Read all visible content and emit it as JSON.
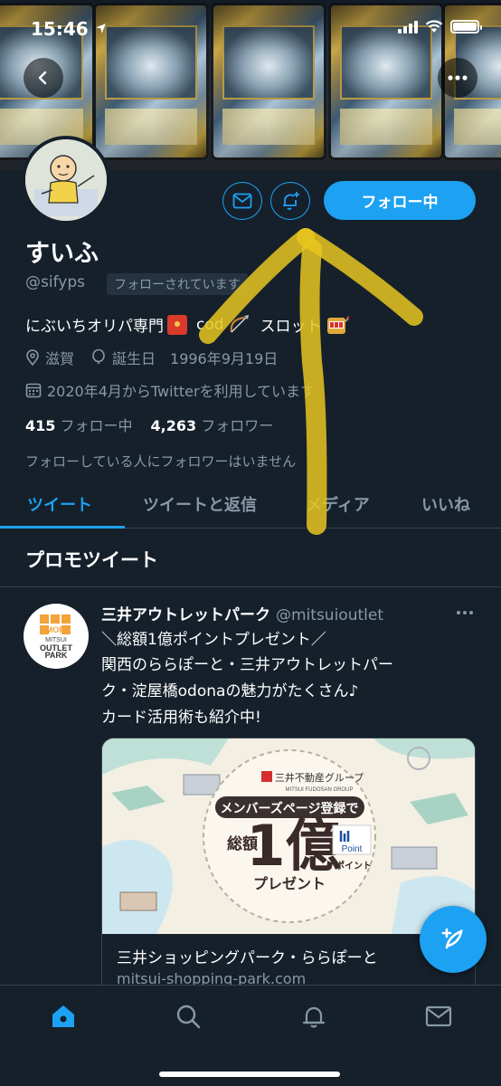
{
  "status_bar": {
    "time": "15:46"
  },
  "profile": {
    "name": "すいふ",
    "handle": "@sifyps",
    "followed_badge": "フォローされています",
    "follow_button": "フォロー中",
    "bio_part1": "にぶいちオリパ専門",
    "bio_part2": "cod",
    "bio_part3": "スロット",
    "location": "滋賀",
    "birthday": "誕生日　1996年9月19日",
    "joined": "2020年4月からTwitterを利用しています",
    "following_count": "415",
    "following_label": "フォロー中",
    "followers_count": "4,263",
    "followers_label": "フォロワー",
    "no_followers_note": "フォローしている人にフォロワーはいません"
  },
  "tabs": [
    {
      "label": "ツイート",
      "active": true
    },
    {
      "label": "ツイートと返信",
      "active": false
    },
    {
      "label": "メディア",
      "active": false
    },
    {
      "label": "いいね",
      "active": false
    }
  ],
  "promo": {
    "header": "プロモツイート",
    "account_name": "三井アウトレットパーク",
    "account_handle": "@mitsuioutlet",
    "avatar_text_top": "MOP",
    "avatar_text_1": "MITSUI",
    "avatar_text_2": "OUTLET",
    "avatar_text_3": "PARK",
    "lines": [
      "＼総額1億ポイントプレゼント／",
      "関西のららぽーと・三井アウトレットパー",
      "ク・淀屋橋odonaの魅力がたくさん♪",
      "カード活用術も紹介中!"
    ],
    "card_image": {
      "group": "三井不動産グループ",
      "group_en": "MITSUI FUDOSAN GROUP",
      "register": "メンバーズページ登録で",
      "total": "総額",
      "amount": "1億",
      "point_label": "ポイント",
      "present": "プレゼント",
      "point_logo": "Point"
    },
    "card_title": "三井ショッピングパーク・ららぽーと",
    "card_url": "mitsui-shopping-park.com"
  },
  "colors": {
    "background": "#15202b",
    "accent": "#1da1f2",
    "muted": "#8899a6",
    "annotation": "#e8c520"
  }
}
